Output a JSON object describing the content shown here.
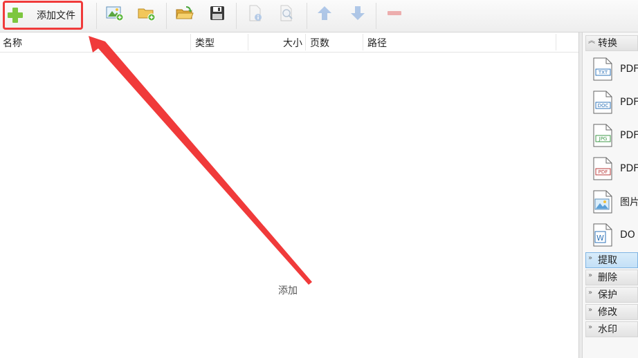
{
  "toolbar": {
    "add_file_label": "添加文件"
  },
  "table": {
    "columns": [
      "名称",
      "类型",
      "大小",
      "页数",
      "路径"
    ],
    "empty_hint": "添加"
  },
  "right_panel": {
    "groups": [
      "转换",
      "提取",
      "删除",
      "保护",
      "修改",
      "水印"
    ],
    "convert_items": [
      {
        "text": "PDF",
        "badge": "TXT"
      },
      {
        "text": "PDF",
        "badge": "DOC"
      },
      {
        "text": "PDF",
        "badge": "JPG"
      },
      {
        "text": "PDF",
        "badge": "PDF"
      },
      {
        "text": "图片",
        "badge": ""
      },
      {
        "text": "DO",
        "badge": "W"
      }
    ]
  },
  "colors": {
    "highlight": "#f03a3a",
    "accent_blue": "#5a8fd6",
    "green": "#7dc63f"
  }
}
